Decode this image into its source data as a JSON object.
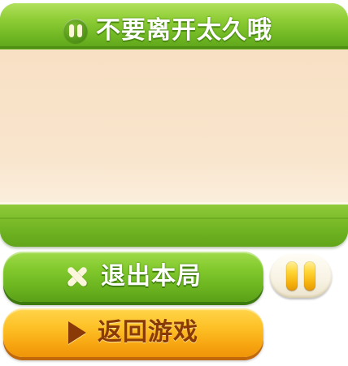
{
  "dialog": {
    "title": "不要离开太久哦",
    "title_icon": "pause-icon"
  },
  "buttons": {
    "exit": {
      "label": "退出本局",
      "icon": "close-icon"
    },
    "return": {
      "label": "返回游戏",
      "icon": "play-icon"
    },
    "pause_toggle": {
      "icon": "pause-icon"
    }
  },
  "colors": {
    "primary_green": "#6cb324",
    "content_bg": "#f9e5cd",
    "accent_orange": "#fdc026",
    "return_text": "#8a3a06"
  }
}
